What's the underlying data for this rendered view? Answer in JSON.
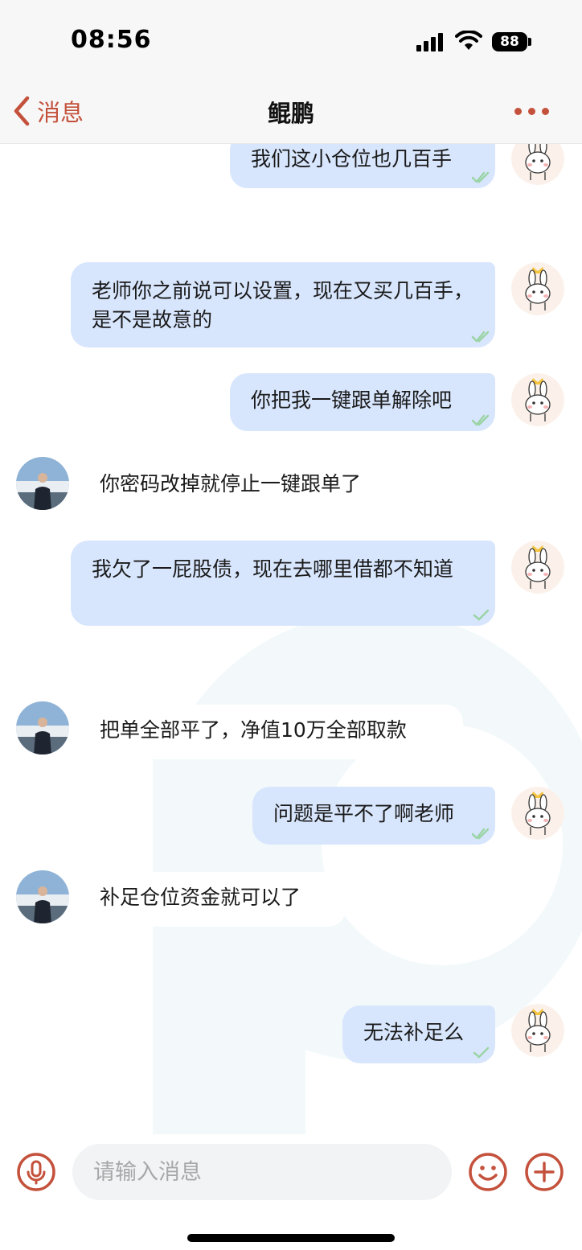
{
  "status_bar": {
    "time": "08:56",
    "battery": "88"
  },
  "nav": {
    "back_label": "消息",
    "title": "鲲鹏"
  },
  "messages": [
    {
      "side": "out",
      "text": "我们这小仓位也几百手"
    },
    {
      "side": "out",
      "text": "老师你之前说可以设置，现在又买几百手，是不是故意的"
    },
    {
      "side": "out",
      "text": "你把我一键跟单解除吧"
    },
    {
      "side": "in",
      "text": "你密码改掉就停止一键跟单了"
    },
    {
      "side": "out",
      "text": "我欠了一屁股债，现在去哪里借都不知道"
    },
    {
      "side": "in",
      "text": "把单全部平了，净值10万全部取款"
    },
    {
      "side": "out",
      "text": "问题是平不了啊老师"
    },
    {
      "side": "in",
      "text": "补足仓位资金就可以了"
    },
    {
      "side": "out",
      "text": "无法补足么"
    }
  ],
  "input": {
    "placeholder": "请输入消息"
  },
  "colors": {
    "accent": "#c4513c",
    "outgoing_bubble": "#d8e6fd",
    "incoming_bubble": "#ffffff",
    "read_check": "#9bd4a6"
  },
  "icons": {
    "back": "chevron-left-icon",
    "more": "more-dots-icon",
    "mic": "microphone-icon",
    "emoji": "smiley-icon",
    "plus": "plus-circle-icon",
    "read": "double-check-icon"
  }
}
